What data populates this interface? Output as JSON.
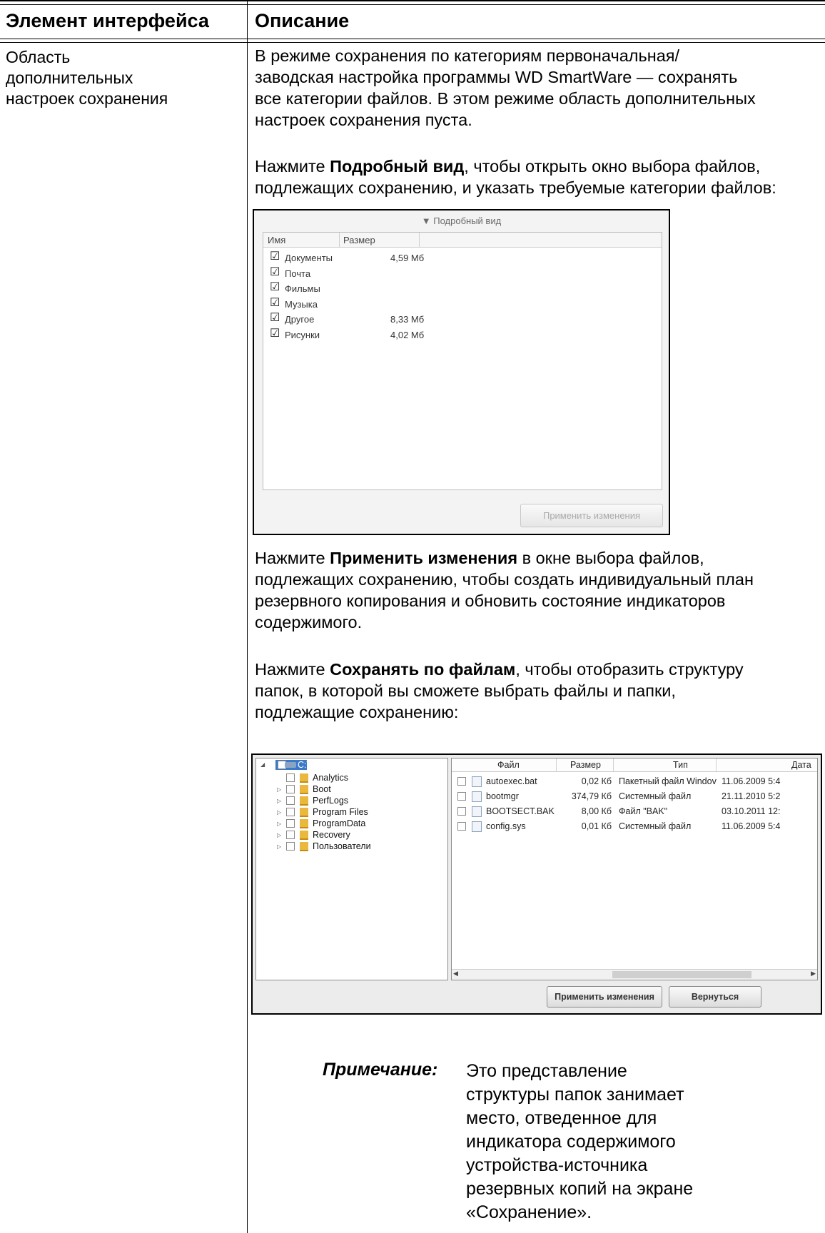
{
  "table": {
    "header_col1": "Элемент интерфейса",
    "header_col2": "Описание",
    "left_cell": [
      "Область",
      "дополнительных",
      "настроек сохранения"
    ]
  },
  "description": {
    "p1": [
      "В режиме сохранения по категориям первоначальная/",
      "заводская настройка программы WD SmartWare — сохранять",
      "все категории файлов. В этом режиме область дополнительных",
      "настроек сохранения пуста."
    ],
    "p2": {
      "pre": "Нажмите ",
      "bold": "Подробный вид",
      "post": ", чтобы открыть окно выбора файлов,",
      "line2": "подлежащих сохранению, и указать требуемые категории файлов:"
    },
    "p3": {
      "pre": "Нажмите ",
      "bold": "Применить изменения",
      "post": " в окне выбора файлов,",
      "lines": [
        "подлежащих сохранению, чтобы создать индивидуальный план",
        "резервного копирования и обновить состояние индикаторов",
        "содержимого."
      ]
    },
    "p4": {
      "pre": "Нажмите ",
      "bold": "Сохранять по файлам",
      "post": ", чтобы отобразить структуру",
      "lines": [
        "папок, в которой вы сможете выбрать файлы и папки,",
        "подлежащие сохранению:"
      ]
    }
  },
  "categories_view": {
    "title": "▼ Подробный вид",
    "col_name": "Имя",
    "col_size": "Размер",
    "rows": [
      {
        "name": "Документы",
        "size": "4,59 Мб",
        "checked": true
      },
      {
        "name": "Почта",
        "size": "",
        "checked": true
      },
      {
        "name": "Фильмы",
        "size": "",
        "checked": true
      },
      {
        "name": "Музыка",
        "size": "",
        "checked": true
      },
      {
        "name": "Другое",
        "size": "8,33 Мб",
        "checked": true
      },
      {
        "name": "Рисунки",
        "size": "4,02 Мб",
        "checked": true
      }
    ],
    "apply_label": "Применить изменения"
  },
  "files_view": {
    "root": "C:\\",
    "tree": [
      "Analytics",
      "Boot",
      "PerfLogs",
      "Program Files",
      "ProgramData",
      "Recovery",
      "Пользователи"
    ],
    "columns": {
      "file": "Файл",
      "size": "Размер",
      "type": "Тип",
      "date": "Дата"
    },
    "files": [
      {
        "name": "autoexec.bat",
        "size": "0,02 Кб",
        "type": "Пакетный файл Windov",
        "date": "11.06.2009 5:4"
      },
      {
        "name": "bootmgr",
        "size": "374,79 Кб",
        "type": "Системный файл",
        "date": "21.11.2010 5:2"
      },
      {
        "name": "BOOTSECT.BAK",
        "size": "8,00 Кб",
        "type": "Файл \"BAK\"",
        "date": "03.10.2011 12:"
      },
      {
        "name": "config.sys",
        "size": "0,01 Кб",
        "type": "Системный файл",
        "date": "11.06.2009 5:4"
      }
    ],
    "apply_label": "Применить изменения",
    "back_label": "Вернуться"
  },
  "note": {
    "label": "Примечание:",
    "lines": [
      "Это представление",
      "структуры папок занимает",
      "место, отведенное для",
      "индикатора содержимого",
      "устройства-источника",
      "резервных копий на экране",
      "«Сохранение»."
    ]
  }
}
